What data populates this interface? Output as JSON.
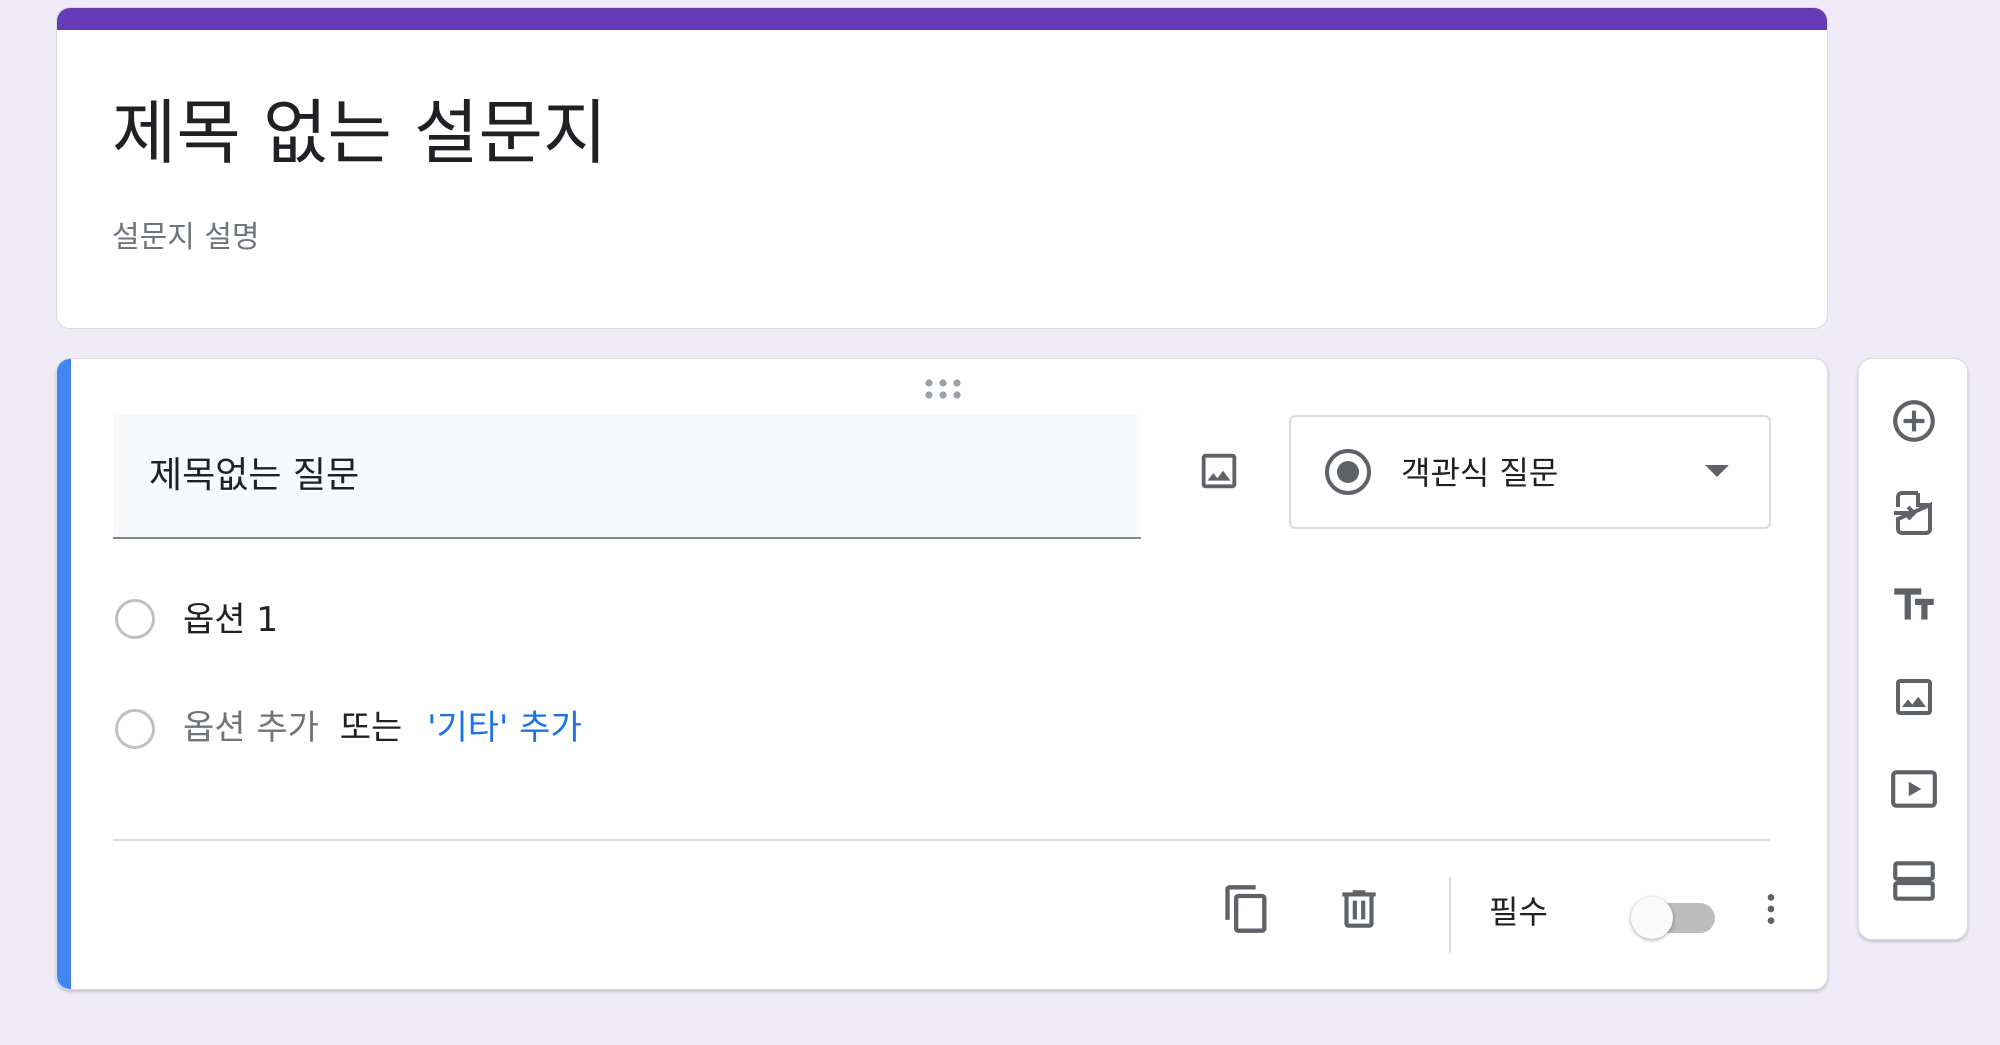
{
  "form": {
    "title": "제목 없는 설문지",
    "description": "설문지 설명"
  },
  "question": {
    "title": "제목없는 질문",
    "type_label": "객관식 질문",
    "options": [
      {
        "label": "옵션 1"
      }
    ],
    "add_option_text": "옵션 추가",
    "or_text": "또는",
    "add_other_text": "'기타' 추가",
    "required_label": "필수",
    "required": false
  },
  "side_toolbar": {
    "items": [
      {
        "icon": "add-question-icon"
      },
      {
        "icon": "import-questions-icon"
      },
      {
        "icon": "add-title-description-icon"
      },
      {
        "icon": "add-image-icon"
      },
      {
        "icon": "add-video-icon"
      },
      {
        "icon": "add-section-icon"
      }
    ]
  },
  "colors": {
    "theme": "#673ab7",
    "active_accent": "#4285f4",
    "link": "#1a73e8",
    "background": "#efebf8"
  }
}
